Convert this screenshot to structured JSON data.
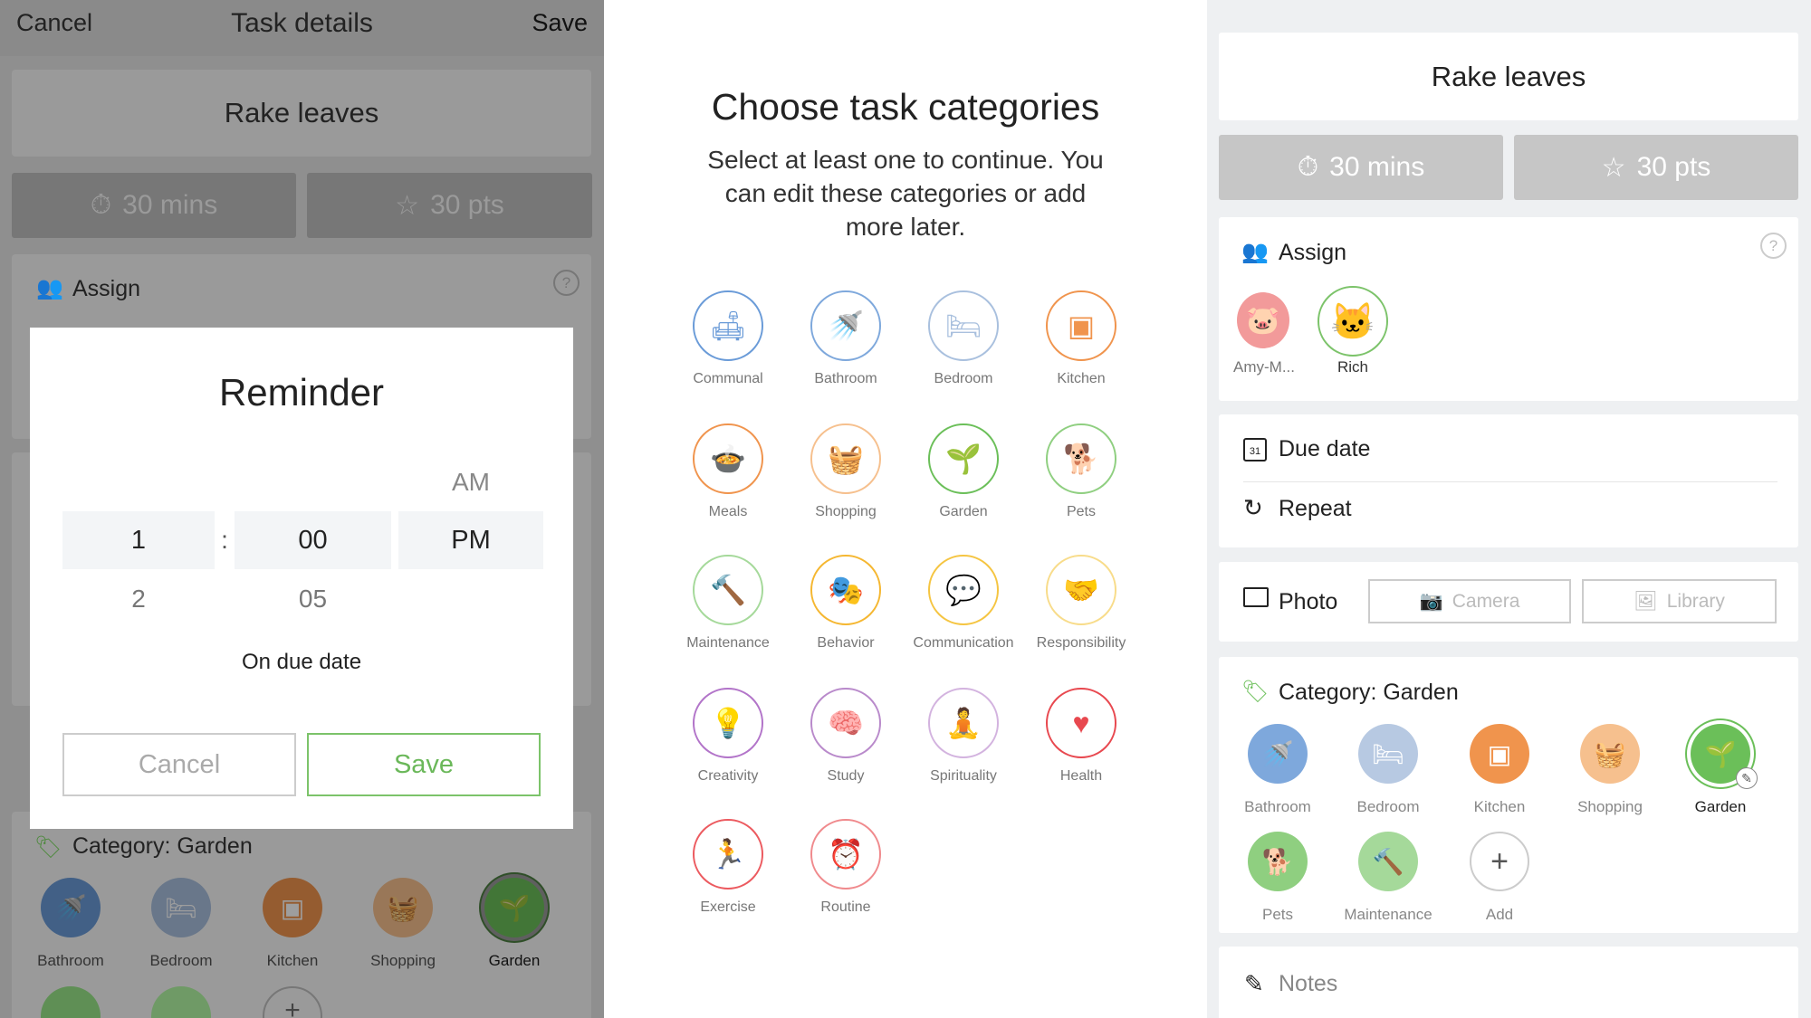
{
  "left": {
    "header": {
      "cancel": "Cancel",
      "title": "Task details",
      "save": "Save"
    },
    "task_name": "Rake leaves",
    "duration": "30 mins",
    "points": "30 pts",
    "assign_label": "Assign",
    "category_title": "Category: Garden",
    "categories": [
      {
        "label": "Bathroom",
        "icon": "shower-icon",
        "color": "#6a9bd8"
      },
      {
        "label": "Bedroom",
        "icon": "bed-icon",
        "color": "#a9c0de"
      },
      {
        "label": "Kitchen",
        "icon": "oven-icon",
        "color": "#f0944d"
      },
      {
        "label": "Shopping",
        "icon": "basket-icon",
        "color": "#f6c08e"
      },
      {
        "label": "Garden",
        "icon": "plant-icon",
        "color": "#6bbf59",
        "selected": true
      }
    ],
    "reminder": {
      "title": "Reminder",
      "am": "AM",
      "hour": "1",
      "separator": ":",
      "minute": "00",
      "period": "PM",
      "next_hour": "2",
      "next_minute": "05",
      "subtitle": "On due date",
      "cancel": "Cancel",
      "save": "Save"
    }
  },
  "middle": {
    "title": "Choose task categories",
    "subtitle_lines": [
      "Select at least one to continue. You",
      "can edit these categories or add",
      "more later."
    ],
    "categories": [
      {
        "label": "Communal",
        "icon": "sofa-icon",
        "color": "#6a9bd8"
      },
      {
        "label": "Bathroom",
        "icon": "shower-icon",
        "color": "#7ea8dc"
      },
      {
        "label": "Bedroom",
        "icon": "bed-icon",
        "color": "#a9c0de"
      },
      {
        "label": "Kitchen",
        "icon": "oven-icon",
        "color": "#f0944d"
      },
      {
        "label": "Meals",
        "icon": "pot-icon",
        "color": "#f0944d"
      },
      {
        "label": "Shopping",
        "icon": "basket-icon",
        "color": "#f6c08e"
      },
      {
        "label": "Garden",
        "icon": "plant-icon",
        "color": "#6bbf59"
      },
      {
        "label": "Pets",
        "icon": "dog-icon",
        "color": "#8fcf80"
      },
      {
        "label": "Maintenance",
        "icon": "hammer-icon",
        "color": "#a5d99a"
      },
      {
        "label": "Behavior",
        "icon": "masks-icon",
        "color": "#f5b731"
      },
      {
        "label": "Communication",
        "icon": "speech-bubbles-icon",
        "color": "#f5c542"
      },
      {
        "label": "Responsibility",
        "icon": "handshake-icon",
        "color": "#f8dc8a"
      },
      {
        "label": "Creativity",
        "icon": "lightbulb-icon",
        "color": "#b274c9"
      },
      {
        "label": "Study",
        "icon": "brain-head-icon",
        "color": "#b98acb"
      },
      {
        "label": "Spirituality",
        "icon": "meditation-icon",
        "color": "#d3b3df"
      },
      {
        "label": "Health",
        "icon": "heartbeat-icon",
        "color": "#e8484f"
      },
      {
        "label": "Exercise",
        "icon": "runner-icon",
        "color": "#ec5a5f"
      },
      {
        "label": "Routine",
        "icon": "alarm-clock-icon",
        "color": "#f08a8d"
      }
    ]
  },
  "right": {
    "task_name": "Rake leaves",
    "duration": "30 mins",
    "points": "30 pts",
    "assign_label": "Assign",
    "assignees": [
      {
        "name": "Amy-M...",
        "icon": "pig-avatar-icon",
        "selected": false
      },
      {
        "name": "Rich",
        "icon": "cat-avatar-icon",
        "selected": true
      }
    ],
    "due_date": "Due date",
    "due_date_day": "31",
    "repeat": "Repeat",
    "photo": "Photo",
    "camera": "Camera",
    "library": "Library",
    "category_title": "Category: Garden",
    "categories": [
      {
        "label": "Bathroom",
        "icon": "shower-icon",
        "color": "#7ea8dc"
      },
      {
        "label": "Bedroom",
        "icon": "bed-icon",
        "color": "#b7c9e2"
      },
      {
        "label": "Kitchen",
        "icon": "oven-icon",
        "color": "#f0944d"
      },
      {
        "label": "Shopping",
        "icon": "basket-icon",
        "color": "#f6c08e"
      },
      {
        "label": "Garden",
        "icon": "plant-icon",
        "color": "#6bbf59",
        "selected": true
      },
      {
        "label": "Pets",
        "icon": "dog-icon",
        "color": "#8fcf80"
      },
      {
        "label": "Maintenance",
        "icon": "hammer-icon",
        "color": "#a5d99a"
      },
      {
        "label": "Add",
        "icon": "plus-icon",
        "color": "#ffffff"
      }
    ],
    "notes": "Notes"
  },
  "colors": {
    "accent_green": "#7cc36a",
    "text": "#222222",
    "muted": "#888888"
  }
}
